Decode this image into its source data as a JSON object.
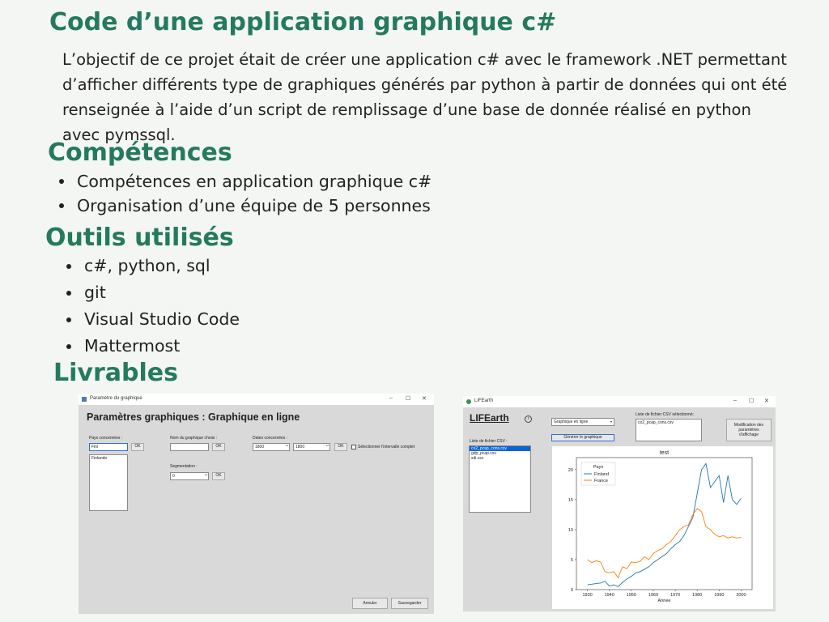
{
  "title": "Code d’une application graphique c#",
  "description": "L’objectif de ce projet était de créer une application c# avec le framework .NET permettant d’afficher différents type de graphiques générés par python à partir de données qui ont été renseignée à l’aide d’un script de remplissage d’une base de donnée réalisé en python avec pymssql.",
  "competences": {
    "heading": "Compétences",
    "items": [
      "Compétences en application graphique c#",
      "Organisation d’une équipe de 5 personnes"
    ]
  },
  "outils": {
    "heading": "Outils utilisés",
    "items": [
      "c#, python, sql",
      "git",
      "Visual Studio Code",
      "Mattermost"
    ]
  },
  "livrables": {
    "heading": "Livrables"
  },
  "shot1": {
    "window_title": "Paramètre du graphique",
    "heading": "Paramètres graphiques : Graphique en ligne",
    "pays_label": "Pays concernées :",
    "pays_value": "Finl",
    "list_item": "Finlande",
    "ok": "OK",
    "nom_label": "Nom du graphique choisi :",
    "dates_label": "Dates concernées :",
    "date_from": "1800",
    "date_to": "1800",
    "checkbox_label": "Sélectionner l'intervalle complet",
    "seg_label": "Segmentation :",
    "seg_value": "0",
    "annuler": "Annuler",
    "sauvegarder": "Sauvegarder"
  },
  "shot2": {
    "window_title": "LIFEarth",
    "app_title": "LIFEarth",
    "select_value": "Graphique en ligne",
    "generate_button": "Générer le graphique",
    "csv_list_label": "Liste de fichier CSV :",
    "csv_files": [
      "co2_pcap_cons.csv",
      "gdp_pcap.csv",
      "sdi.csv"
    ],
    "selected_label": "Liste de fichier CSV sélectionné:",
    "selected_file": "co2_pcap_cons.csv",
    "settings_button": "Modification des paramètres d'affichage"
  },
  "chart_data": {
    "type": "line",
    "title": "test",
    "xlabel": "Annee",
    "ylabel": "",
    "legend_title": "Pays",
    "legend_position": "top-left",
    "xlim": [
      1925,
      2005
    ],
    "ylim": [
      0,
      22
    ],
    "xticks": [
      1930,
      1940,
      1950,
      1960,
      1970,
      1980,
      1990,
      2000
    ],
    "yticks": [
      0,
      5,
      10,
      15,
      20
    ],
    "x": [
      1930,
      1932,
      1934,
      1936,
      1938,
      1940,
      1942,
      1944,
      1946,
      1948,
      1950,
      1952,
      1954,
      1956,
      1958,
      1960,
      1962,
      1964,
      1966,
      1968,
      1970,
      1972,
      1974,
      1976,
      1978,
      1980,
      1982,
      1984,
      1986,
      1988,
      1990,
      1992,
      1994,
      1996,
      1998,
      2000
    ],
    "series": [
      {
        "name": "Finland",
        "color": "#1f77b4",
        "values": [
          0.8,
          0.9,
          1.0,
          1.1,
          1.4,
          0.6,
          0.8,
          0.5,
          1.2,
          1.8,
          2.2,
          2.8,
          3.0,
          3.4,
          3.8,
          4.5,
          5.0,
          5.5,
          6.0,
          6.8,
          7.5,
          8.0,
          9.0,
          10.5,
          12.0,
          16.0,
          20.0,
          21.0,
          17.0,
          18.0,
          19.0,
          14.5,
          19.0,
          15.0,
          14.2,
          15.2
        ]
      },
      {
        "name": "France",
        "color": "#ff7f0e",
        "values": [
          5.0,
          4.5,
          4.8,
          4.6,
          3.0,
          2.8,
          3.0,
          2.0,
          3.8,
          3.5,
          4.6,
          4.5,
          4.7,
          5.5,
          5.0,
          6.0,
          6.5,
          6.8,
          7.5,
          8.0,
          9.0,
          10.0,
          10.5,
          10.8,
          12.5,
          13.5,
          13.0,
          10.5,
          10.0,
          9.2,
          8.8,
          9.0,
          8.6,
          8.8,
          8.6,
          8.7
        ]
      }
    ]
  }
}
